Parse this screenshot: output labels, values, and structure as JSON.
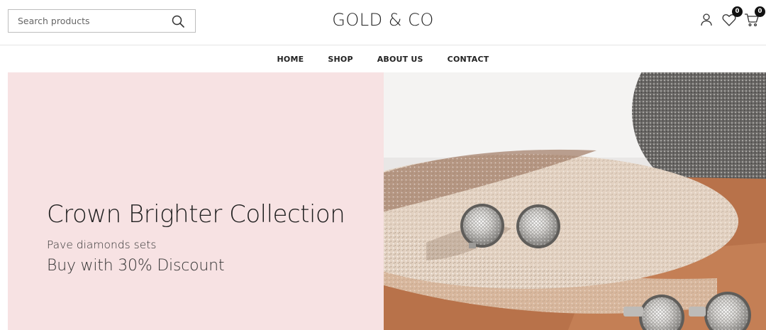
{
  "search": {
    "placeholder": "Search products",
    "value": ""
  },
  "brand": {
    "logo_text": "GOLD & CO"
  },
  "header_icons": {
    "account_icon": "user-icon",
    "wishlist_icon": "heart-icon",
    "wishlist_count": "0",
    "cart_icon": "cart-icon",
    "cart_count": "0"
  },
  "nav": {
    "items": [
      {
        "label": "HOME"
      },
      {
        "label": "SHOP"
      },
      {
        "label": "ABOUT US"
      },
      {
        "label": "CONTACT"
      }
    ]
  },
  "hero": {
    "title": "Crown Brighter Collection",
    "subtitle": "Pave diamonds sets",
    "discount": "Buy with 30% Discount",
    "background_color": "#f7e2e3"
  }
}
